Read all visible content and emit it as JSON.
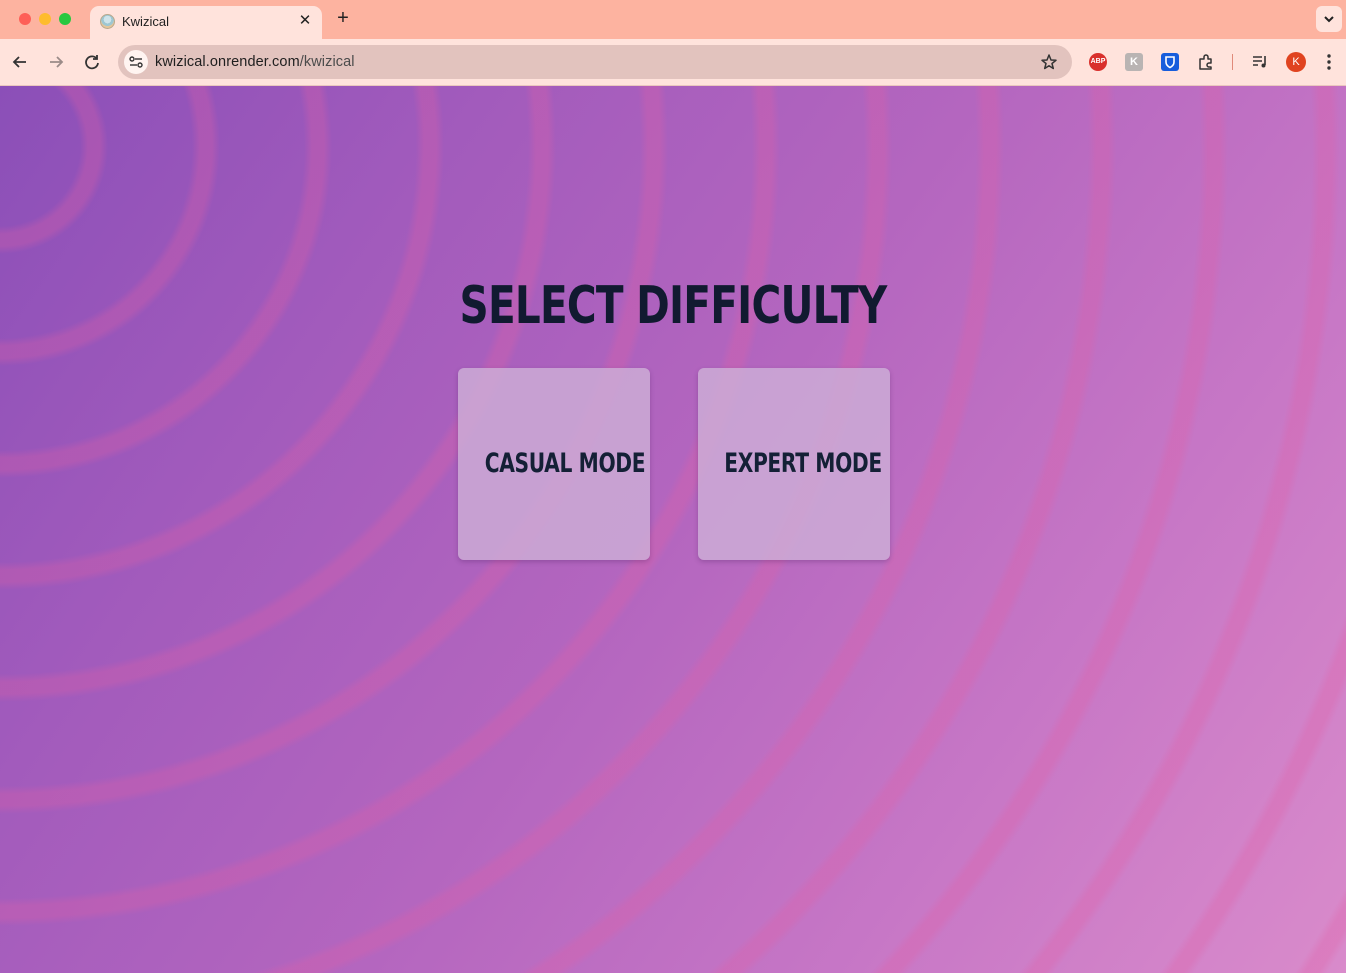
{
  "browser": {
    "tab_title": "Kwizical",
    "tab_close_glyph": "✕",
    "new_tab_glyph": "+",
    "url_host": "kwizical.onrender.com",
    "url_path": "/kwizical",
    "profile_initial": "K",
    "extensions": {
      "abp_label": "ABP",
      "k_label": "K"
    }
  },
  "page": {
    "heading": "Select Difficulty",
    "modes": [
      {
        "label": "Casual Mode"
      },
      {
        "label": "Expert Mode"
      }
    ]
  },
  "colors": {
    "tab_strip": "#fdb3a0",
    "toolbar": "#ffe3dc",
    "heading_text": "#111a30",
    "card_bg": "#cdafd7",
    "gradient_start": "#8b4fb8",
    "gradient_end": "#d98bcb"
  },
  "icons": [
    "back-arrow-icon",
    "forward-arrow-icon",
    "reload-icon",
    "site-info-icon",
    "bookmark-star-icon",
    "adblock-icon",
    "extension-k-icon",
    "bitwarden-icon",
    "extensions-puzzle-icon",
    "media-control-icon",
    "more-menu-icon",
    "tab-list-chevron-icon"
  ]
}
